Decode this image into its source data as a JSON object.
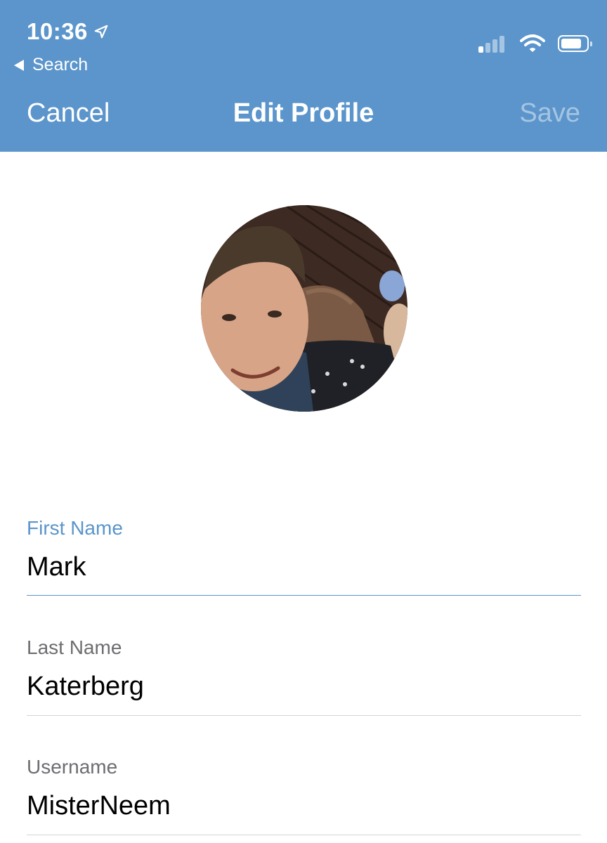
{
  "status_bar": {
    "time": "10:36",
    "back_app": "Search",
    "signal_bars": 4,
    "signal_active": 1,
    "battery_level": 0.86
  },
  "nav": {
    "cancel_label": "Cancel",
    "title": "Edit Profile",
    "save_label": "Save"
  },
  "form": {
    "first_name": {
      "label": "First Name",
      "value": "Mark"
    },
    "last_name": {
      "label": "Last Name",
      "value": "Katerberg"
    },
    "username": {
      "label": "Username",
      "value": "MisterNeem"
    }
  },
  "colors": {
    "header_bg": "#5b95cb",
    "accent": "#5b95cb",
    "label": "#6d6d72",
    "divider": "#d4d4d8"
  },
  "icons": {
    "location": "location-arrow-icon",
    "back": "back-triangle-icon",
    "signal": "cellular-signal-icon",
    "wifi": "wifi-icon",
    "battery": "battery-icon"
  }
}
